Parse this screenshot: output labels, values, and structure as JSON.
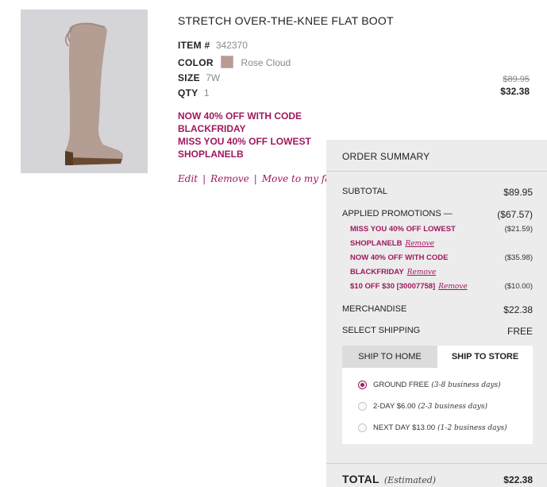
{
  "product": {
    "title": "STRETCH OVER-THE-KNEE FLAT BOOT",
    "item_label": "ITEM #",
    "item_value": "342370",
    "color_label": "COLOR",
    "color_value": "Rose Cloud",
    "swatch_color": "#b79c94",
    "size_label": "SIZE",
    "size_value": "7W",
    "qty_label": "QTY",
    "qty_value": "1",
    "original_price": "$89.95",
    "sale_price": "$32.38",
    "promo_lines": [
      "NOW 40% OFF WITH CODE",
      "BLACKFRIDAY",
      "MISS YOU 40% OFF LOWEST",
      "SHOPLANELB"
    ],
    "actions": {
      "edit": "Edit",
      "remove": "Remove",
      "move": "Move to my fav"
    }
  },
  "summary": {
    "heading": "ORDER SUMMARY",
    "subtotal_label": "SUBTOTAL",
    "subtotal_value": "$89.95",
    "applied_label": "APPLIED PROMOTIONS",
    "applied_toggle": "—",
    "applied_value": "($67.57)",
    "promotions": [
      {
        "line1": "MISS YOU 40% OFF LOWEST",
        "line2": "SHOPLANELB",
        "remove": "Remove",
        "amount": "($21.59)"
      },
      {
        "line1": "NOW 40% OFF WITH CODE",
        "line2": "BLACKFRIDAY",
        "remove": "Remove",
        "amount": "($35.98)"
      },
      {
        "line1": "$10 OFF $30 [30007758]",
        "remove": "Remove",
        "amount": "($10.00)"
      }
    ],
    "merch_label": "MERCHANDISE",
    "merch_value": "$22.38",
    "shipping_label": "SELECT SHIPPING",
    "shipping_value": "FREE",
    "tabs": {
      "home": "SHIP TO HOME",
      "store": "SHIP TO STORE"
    },
    "options": [
      {
        "name": "GROUND FREE",
        "detail": "(3-8 business days)",
        "selected": true
      },
      {
        "name": "2-DAY $6.00",
        "detail": "(2-3 business days)",
        "selected": false
      },
      {
        "name": "NEXT DAY $13.00",
        "detail": "(1-2 business days)",
        "selected": false
      }
    ],
    "total_label": "TOTAL",
    "total_note": "(Estimated)",
    "total_value": "$22.38"
  },
  "colors": {
    "accent": "#a0185f",
    "panel": "#ececec"
  }
}
